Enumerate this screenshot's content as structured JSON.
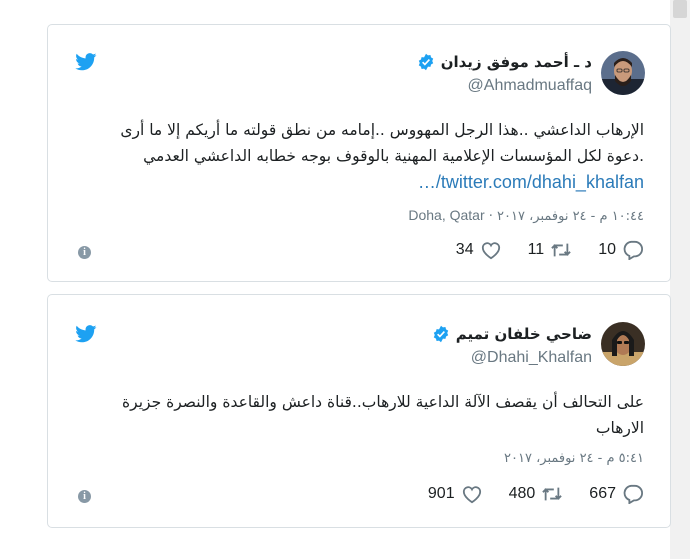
{
  "tweets": [
    {
      "name": "د ـ أحمد موفق زيدان",
      "handle": "@Ahmadmuaffaq",
      "text_line1": "الإرهاب الداعشي ..هذا الرجل المهووس ..إمامه من نطق قولته ما أريكم إلا ما أرى",
      "text_line2": ".دعوة لكل المؤسسات الإعلامية المهنية بالوقوف بوجه خطابه الداعشي العدمي",
      "link": "twitter.com/dhahi_khalfan/…",
      "time": "١٠:٤٤ م - ٢٤ نوفمبر، ٢٠١٧",
      "location": "Doha, Qatar",
      "replies": "10",
      "retweets": "11",
      "likes": "34"
    },
    {
      "name": "ضاحي خلفان تميم",
      "handle": "@Dhahi_Khalfan",
      "text_line1": "على التحالف أن يقصف الآلة الداعية للارهاب..قناة داعش والقاعدة والنصرة جزيرة",
      "text_line2": "الارهاب",
      "time": "٥:٤١ م - ٢٤ نوفمبر، ٢٠١٧",
      "replies": "667",
      "retweets": "480",
      "likes": "901"
    }
  ],
  "icons": {
    "bird": "twitter-bird-icon",
    "verified": "verified-badge-icon",
    "reply": "reply-icon",
    "retweet": "retweet-icon",
    "like": "heart-icon",
    "info": "info-icon"
  },
  "colors": {
    "brand": "#1da1f2",
    "link": "#2b7bb9",
    "muted": "#697882",
    "text": "#1c2022",
    "border": "#d9dfe3"
  }
}
